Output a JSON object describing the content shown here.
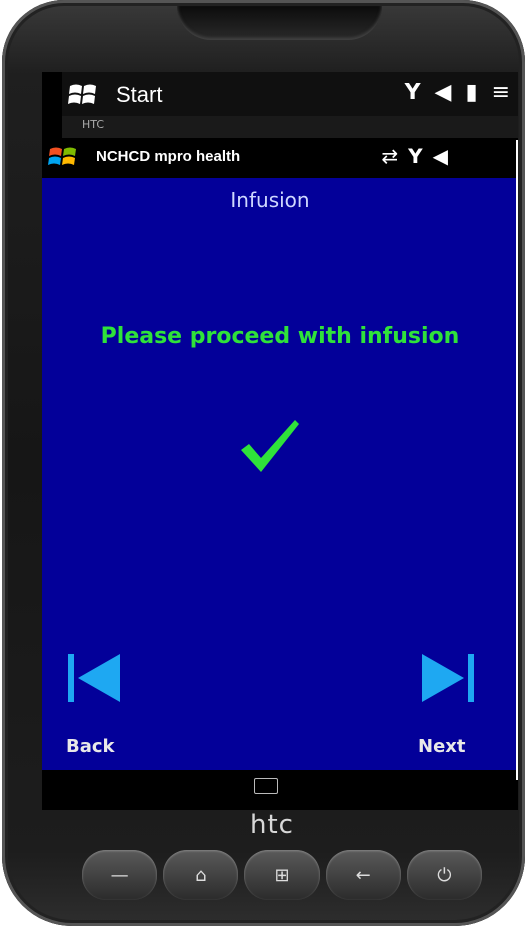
{
  "system_bar": {
    "title": "Start",
    "icons": [
      "signal-icon",
      "speaker-icon",
      "battery-icon",
      "menu-icon"
    ]
  },
  "htc_bar": {
    "label": "HTC"
  },
  "app_bar": {
    "title": "NCHCD mpro health",
    "icons": [
      "sync-icon",
      "signal-icon",
      "speaker-icon"
    ]
  },
  "screen": {
    "heading": "Infusion",
    "message": "Please proceed with infusion",
    "status_icon": "checkmark-icon",
    "back_label": "Back",
    "next_label": "Next"
  },
  "device": {
    "brand": "htc"
  },
  "colors": {
    "content_bg": "#030099",
    "message": "#2fe23a",
    "nav_arrow": "#1ea8f2",
    "heading": "#cfd8ff"
  }
}
